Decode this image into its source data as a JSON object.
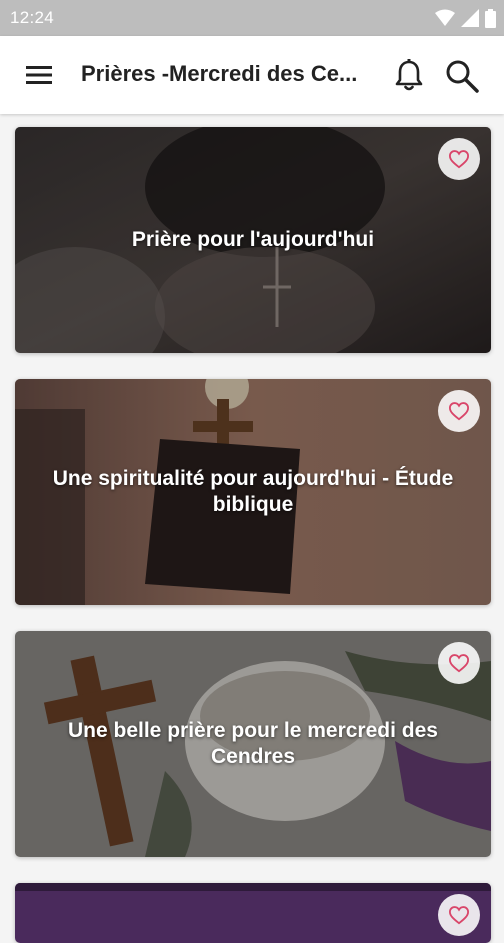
{
  "status_bar": {
    "time": "12:24"
  },
  "app_bar": {
    "title": "Prières -Mercredi des Ce..."
  },
  "cards": [
    {
      "title": "Prière pour l'aujourd'hui"
    },
    {
      "title": "Une spiritualité pour aujourd'hui - Étude biblique"
    },
    {
      "title": "Une belle prière pour le mercredi des Cendres"
    }
  ],
  "colors": {
    "status_bar": "#bdbdbd",
    "app_bar": "#ffffff",
    "favorite_icon": "#d9466a",
    "card4_tint": "#4a2a5c"
  }
}
